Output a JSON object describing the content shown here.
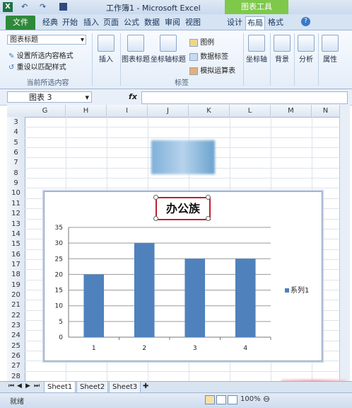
{
  "window": {
    "title": "工作簿1 - Microsoft Excel",
    "context_header": "图表工具"
  },
  "ribbon_tabs": [
    "文件",
    "经典",
    "开始",
    "插入",
    "页面",
    "公式",
    "数据",
    "审阅",
    "视图",
    "设计",
    "布局",
    "格式"
  ],
  "ribbon": {
    "current_selection": {
      "dropdown_value": "图表标题",
      "format_selection": "设置所选内容格式",
      "reset_style": "重设以匹配样式",
      "label": "当前所选内容"
    },
    "insert": "插入",
    "chart_title": "图表标题",
    "axis_titles": "坐标轴标题",
    "legend": "图例",
    "data_labels": "数据标签",
    "data_table": "模拟运算表",
    "labels_group": "标签",
    "axes": "坐标轴",
    "background": "背景",
    "analysis": "分析",
    "properties": "属性"
  },
  "formula_bar": {
    "name_box": "图表 3",
    "fx": "fx",
    "value": ""
  },
  "columns": [
    "G",
    "H",
    "I",
    "J",
    "K",
    "L",
    "M",
    "N"
  ],
  "rows": [
    "3",
    "4",
    "5",
    "6",
    "7",
    "8",
    "9",
    "10",
    "11",
    "12",
    "13",
    "14",
    "15",
    "16",
    "17",
    "18",
    "19",
    "20",
    "21",
    "22",
    "23",
    "24",
    "25",
    "26",
    "27",
    "28"
  ],
  "chart_data": {
    "type": "bar",
    "title": "办公族",
    "categories": [
      "1",
      "2",
      "3",
      "4"
    ],
    "series": [
      {
        "name": "系列1",
        "values": [
          20,
          30,
          25,
          25
        ],
        "color": "#4f81bd"
      }
    ],
    "ylim": [
      0,
      35
    ],
    "yticks": [
      "0",
      "5",
      "10",
      "15",
      "20",
      "25",
      "30",
      "35"
    ],
    "grid": true,
    "legend_position": "right"
  },
  "sheets": [
    "Sheet1",
    "Sheet2",
    "Sheet3"
  ],
  "status": {
    "ready": "就绪",
    "zoom": "100%"
  }
}
